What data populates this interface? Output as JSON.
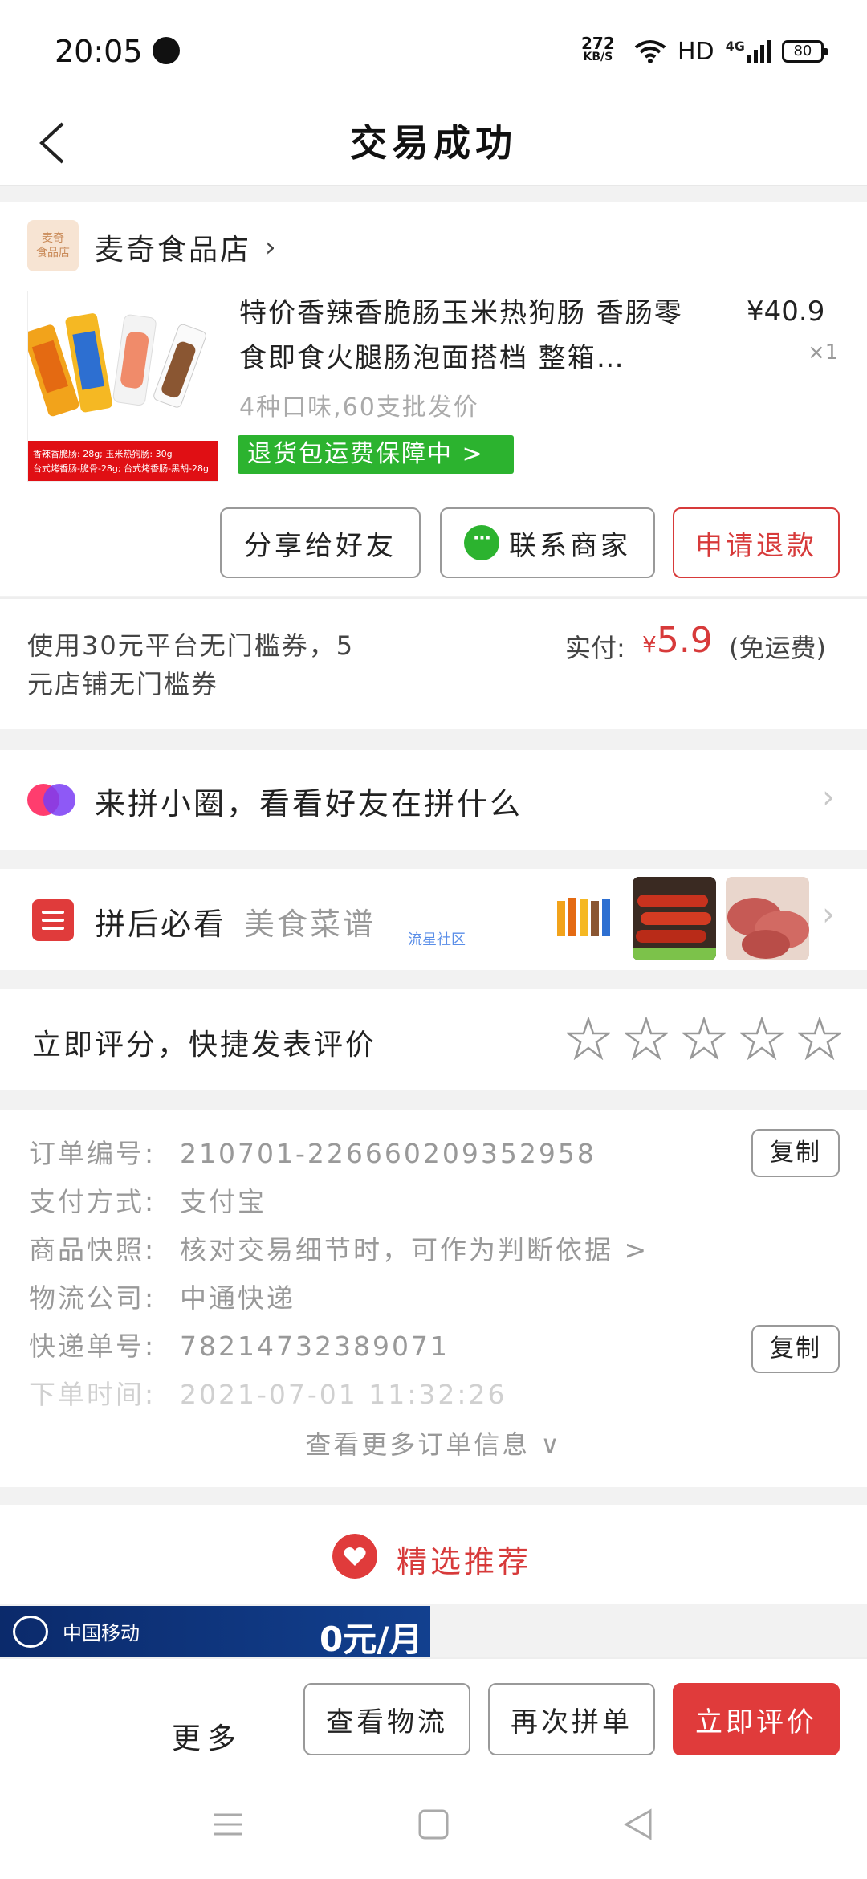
{
  "status_bar": {
    "time": "20:05",
    "speed_value": "272",
    "speed_unit": "KB/S",
    "hd_label": "HD",
    "signal_label": "4G",
    "battery": "80"
  },
  "header": {
    "title": "交易成功",
    "back_icon": "chevron-left-icon"
  },
  "order": {
    "store_logo_text": "麦奇\n食品店",
    "store_name": "麦奇食品店",
    "product_title": "特价香辣香脆肠玉米热狗肠 香肠零食即食火腿肠泡面搭档 整箱…",
    "price": "¥40.9",
    "quantity": "×1",
    "spec": "4种口味,60支批发价",
    "refund_badge": "退货包运费保障中 >",
    "btn_share": "分享给好友",
    "btn_contact": "联系商家",
    "btn_refund": "申请退款"
  },
  "payment": {
    "coupon_text": "使用30元平台无门槛券，5元店铺无门槛券",
    "paid_label": "实付:",
    "paid_currency": "¥",
    "paid_amount": "5.9",
    "paid_note": "(免运费)"
  },
  "group_row": {
    "text": "来拼小圈，看看好友在拼什么"
  },
  "recipe_row": {
    "title": "拼后必看",
    "subtitle": "美食菜谱",
    "tag": "流星社区"
  },
  "rating_row": {
    "text": "立即评分，快捷发表评价",
    "stars": 5
  },
  "order_info": {
    "rows": [
      {
        "label": "订单编号:",
        "value": "210701-226660209352958"
      },
      {
        "label": "支付方式:",
        "value": "支付宝"
      },
      {
        "label": "商品快照:",
        "value": "核对交易细节时，可作为判断依据 >"
      },
      {
        "label": "物流公司:",
        "value": "中通快递"
      },
      {
        "label": "快递单号:",
        "value": "78214732389071"
      },
      {
        "label": "下单时间:",
        "value": "2021-07-01 11:32:26"
      }
    ],
    "copy_label": "复制",
    "more_label": "查看更多订单信息 ∨"
  },
  "recommend": {
    "title": "精选推荐"
  },
  "ad": {
    "left_text": "中国移动",
    "right_text": "0元/月"
  },
  "bottom_bar": {
    "more": "更多",
    "logistics": "查看物流",
    "reorder": "再次拼单",
    "review": "立即评价"
  },
  "colors": {
    "accent_red": "#e03b3b",
    "badge_green": "#2cb32f"
  }
}
